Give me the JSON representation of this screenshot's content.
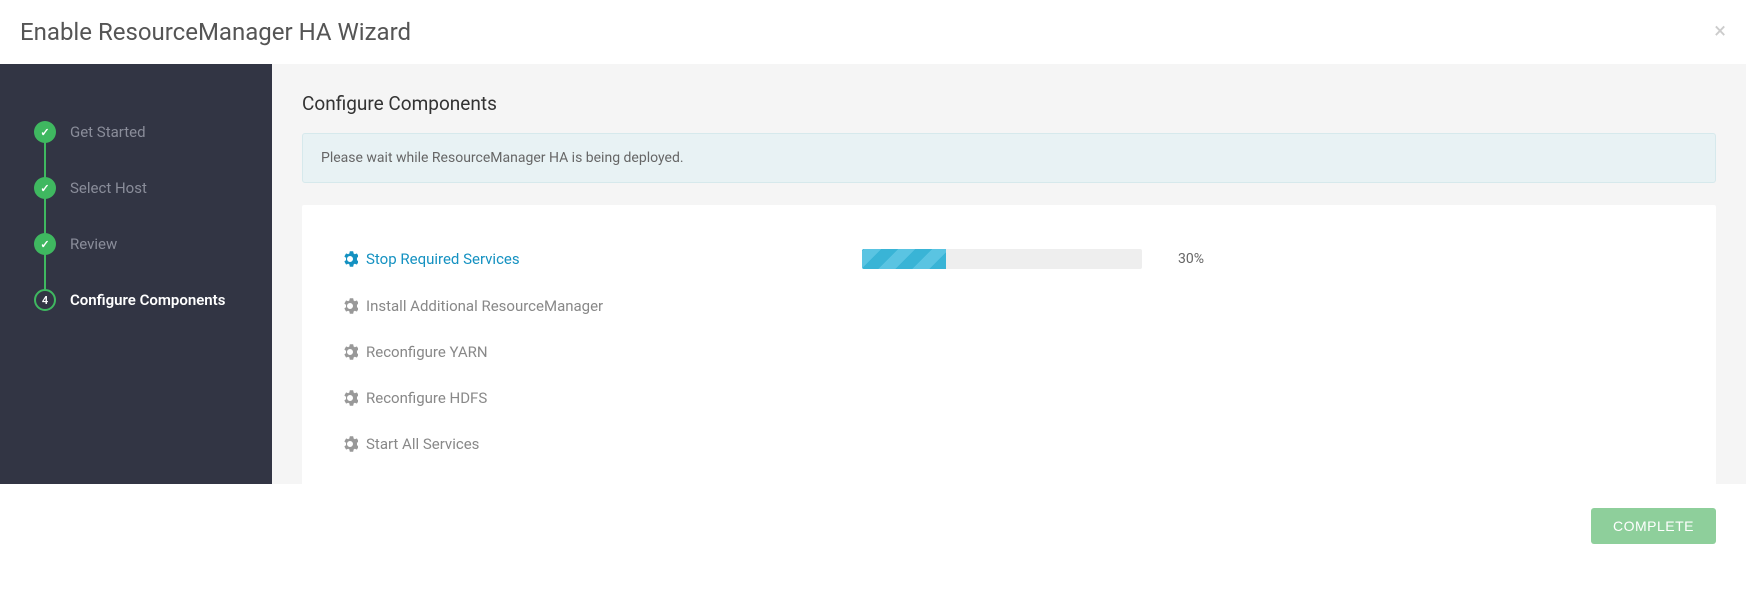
{
  "header": {
    "title": "Enable ResourceManager HA Wizard"
  },
  "sidebar": {
    "steps": [
      {
        "label": "Get Started",
        "status": "completed"
      },
      {
        "label": "Select Host",
        "status": "completed"
      },
      {
        "label": "Review",
        "status": "completed"
      },
      {
        "label": "Configure Components",
        "status": "current",
        "number": "4"
      }
    ]
  },
  "main": {
    "title": "Configure Components",
    "info_message": "Please wait while ResourceManager HA is being deployed.",
    "tasks": [
      {
        "label": "Stop Required Services",
        "active": true,
        "progress_percent": 30,
        "percent_label": "30%"
      },
      {
        "label": "Install Additional ResourceManager",
        "active": false
      },
      {
        "label": "Reconfigure YARN",
        "active": false
      },
      {
        "label": "Reconfigure HDFS",
        "active": false
      },
      {
        "label": "Start All Services",
        "active": false
      }
    ]
  },
  "footer": {
    "complete_label": "COMPLETE"
  },
  "colors": {
    "accent_green": "#3fb860",
    "link_blue": "#1491c1",
    "progress_blue": "#39b4d6"
  }
}
